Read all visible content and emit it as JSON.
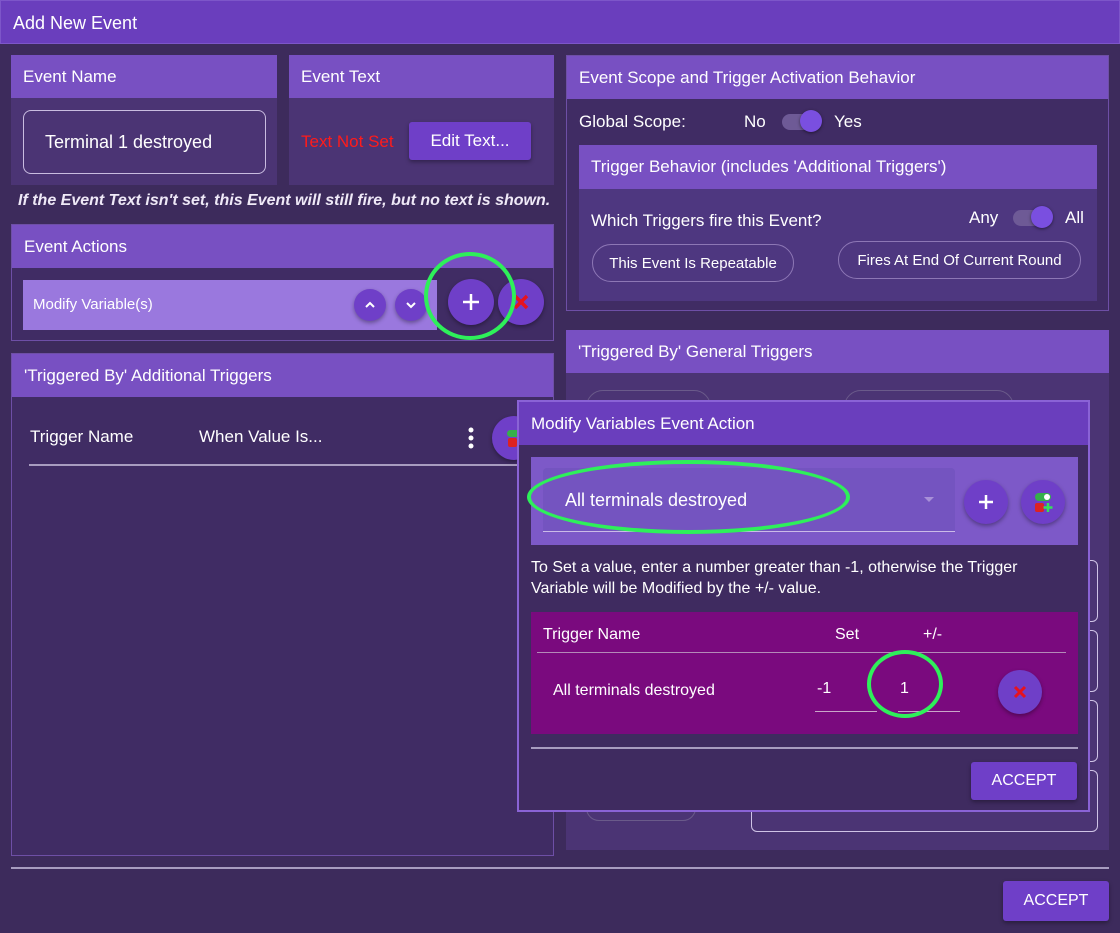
{
  "window": {
    "title": "Add New Event"
  },
  "event_name": {
    "heading": "Event Name",
    "value": "Terminal 1 destroyed"
  },
  "event_text": {
    "heading": "Event Text",
    "status": "Text Not Set",
    "edit_label": "Edit Text..."
  },
  "info_note": "If the Event Text isn't set, this Event will still fire, but no text is shown.",
  "event_actions": {
    "heading": "Event Actions",
    "items": [
      {
        "label": "Modify Variable(s)"
      }
    ]
  },
  "additional_triggers": {
    "heading": "'Triggered By' Additional Triggers",
    "col_name": "Trigger Name",
    "col_value": "When Value Is..."
  },
  "scope": {
    "heading": "Event Scope and Trigger Activation Behavior",
    "global_label": "Global Scope:",
    "no_label": "No",
    "yes_label": "Yes",
    "global_scope_value": "Yes"
  },
  "trigger_behavior": {
    "heading": "Trigger Behavior (includes 'Additional Triggers')",
    "question": "Which Triggers fire this Event?",
    "any_label": "Any",
    "all_label": "All",
    "selected": "All",
    "repeatable_label": "This Event Is Repeatable",
    "end_round_label": "Fires At End Of Current Round"
  },
  "general_triggers": {
    "heading": "'Triggered By' General Triggers"
  },
  "modal": {
    "title": "Modify Variables Event Action",
    "select_value": "All terminals destroyed",
    "help_text": "To Set a value, enter a number greater than -1, otherwise the Trigger Variable will be Modified by the +/- value.",
    "col_name": "Trigger Name",
    "col_set": "Set",
    "col_delta": "+/-",
    "rows": [
      {
        "name": "All terminals destroyed",
        "set": "-1",
        "delta": "1"
      }
    ],
    "accept_label": "ACCEPT"
  },
  "footer": {
    "accept_label": "ACCEPT"
  },
  "colors": {
    "background": "#3d2b5c",
    "panel": "#4b3474",
    "header": "#7850c2",
    "accent": "#6f3fc8",
    "table_bg": "#7a0a7e",
    "error_text": "#ff1b1b",
    "highlight": "#2ef05a"
  },
  "icons": [
    "plus-icon",
    "close-icon",
    "chevron-up-icon",
    "chevron-down-icon",
    "more-vert-icon",
    "toggle-variable-icon",
    "dropdown-arrow-icon"
  ]
}
